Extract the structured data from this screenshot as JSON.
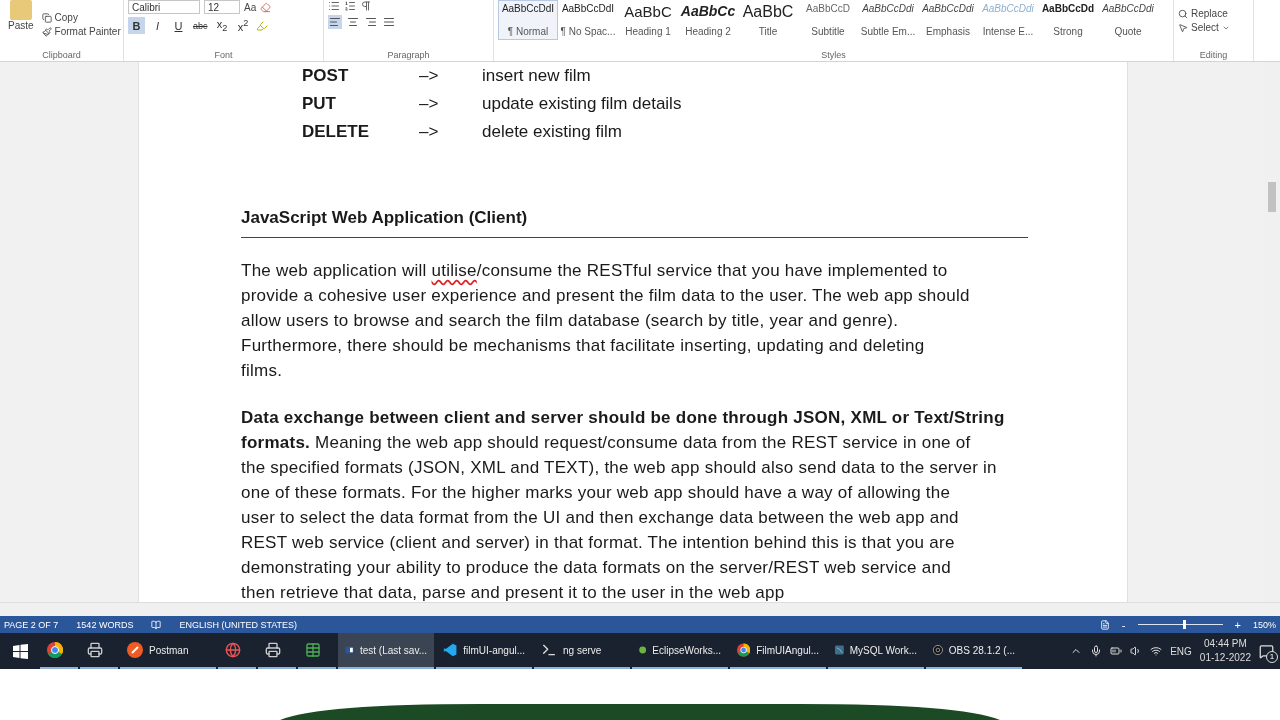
{
  "ribbon": {
    "clipboard": {
      "paste": "Paste",
      "copy": "Copy",
      "format_painter": "Format Painter",
      "label": "Clipboard"
    },
    "font": {
      "name": "Calibri",
      "size": "12",
      "case": "Aa",
      "format_buttons": [
        {
          "label": "B",
          "selected": true,
          "kind": "bold"
        },
        {
          "label": "I",
          "selected": false,
          "kind": "italic"
        },
        {
          "label": "U",
          "selected": false,
          "kind": "underline"
        },
        {
          "label": "abc",
          "selected": false,
          "kind": "strike"
        },
        {
          "label": "x$_{2}$",
          "selected": false,
          "kind": "plain"
        },
        {
          "label": "x$^{2}$",
          "selected": false,
          "kind": "plain"
        }
      ],
      "label": "Font"
    },
    "paragraph": {
      "alignments": [
        {
          "selected": true
        },
        {
          "selected": false
        },
        {
          "selected": false
        },
        {
          "selected": false
        }
      ],
      "label": "Paragraph"
    },
    "styles": {
      "items": [
        {
          "preview": "AaBbCcDdI",
          "name": "¶ Normal",
          "selected": true,
          "kind": "normal"
        },
        {
          "preview": "AaBbCcDdI",
          "name": "¶ No Spac...",
          "selected": false,
          "kind": "normal"
        },
        {
          "preview": "AaBbC",
          "name": "Heading 1",
          "selected": false,
          "kind": "heading"
        },
        {
          "preview": "AaBbCc",
          "name": "Heading 2",
          "selected": false,
          "kind": "heading2"
        },
        {
          "preview": "AaBbC",
          "name": "Title",
          "selected": false,
          "kind": "title"
        },
        {
          "preview": "AaBbCcD",
          "name": "Subtitle",
          "selected": false,
          "kind": "subtitle"
        },
        {
          "preview": "AaBbCcDdi",
          "name": "Subtle Em...",
          "selected": false,
          "kind": "emphasis"
        },
        {
          "preview": "AaBbCcDdi",
          "name": "Emphasis",
          "selected": false,
          "kind": "emphasis"
        },
        {
          "preview": "AaBbCcDdi",
          "name": "Intense E...",
          "selected": false,
          "kind": "intense"
        },
        {
          "preview": "AaBbCcDd",
          "name": "Strong",
          "selected": false,
          "kind": "strong"
        },
        {
          "preview": "AaBbCcDdi",
          "name": "Quote",
          "selected": false,
          "kind": "emphasis"
        }
      ],
      "label": "Styles"
    },
    "editing": {
      "replace": "Replace",
      "select": "Select",
      "label": "Editing"
    }
  },
  "document": {
    "methods": [
      {
        "method": "POST",
        "arrow": "–>",
        "action": "insert new film"
      },
      {
        "method": "PUT",
        "arrow": "–>",
        "action": "update existing film details"
      },
      {
        "method": "DELETE",
        "arrow": "–>",
        "action": "delete existing film"
      }
    ],
    "heading": "JavaScript Web Application (Client)",
    "paragraphs": [
      {
        "lines": [
          [
            {
              "text": "The web application will "
            },
            {
              "text": "utilise",
              "misspelled": true
            },
            {
              "text": "/consume the RESTful service that you have implemented to"
            }
          ],
          [
            {
              "text": "provide a cohesive user experience and present the film data to the user. The web app should"
            }
          ],
          [
            {
              "text": "allow users to browse and search the film database (search by title, year and genre)."
            }
          ],
          [
            {
              "text": "Furthermore, there should be mechanisms that facilitate inserting, updating and deleting"
            }
          ],
          [
            {
              "text": "films."
            }
          ]
        ]
      },
      {
        "lines": [
          [
            {
              "text": "**Data exchange between client and server should be done through JSON, XML or Text/String**"
            }
          ],
          [
            {
              "text": "**formats.** Meaning the web app should request/consume data from the REST service in one of"
            }
          ],
          [
            {
              "text": "the specified formats (JSON, XML and TEXT), the web app should also send data to the server in"
            }
          ],
          [
            {
              "text": "one of these formats. For the higher marks your web app should have a way of allowing the"
            }
          ],
          [
            {
              "text": "user to select the data format from the UI and then exchange data between the web app and"
            }
          ],
          [
            {
              "text": "REST web service (client and server) in that format. The intention behind this is that you are"
            }
          ],
          [
            {
              "text": "demonstrating your ability to produce the data formats on the server/REST web service and"
            }
          ],
          [
            {
              "text": "then retrieve that data, parse and present it to the user in the web app"
            }
          ]
        ]
      }
    ]
  },
  "status_bar": {
    "page": "PAGE 2 OF 7",
    "words": "1542 WORDS",
    "language": "ENGLISH (UNITED STATES)",
    "zoom_out": "-",
    "zoom_in": "+",
    "zoom": {
      "level": 0.53
    },
    "zoom_label": "150%"
  },
  "taskbar": {
    "items": [
      {
        "kind": "chrome",
        "selected": false
      },
      {
        "kind": "app",
        "selected": false
      },
      {
        "kind": "postman",
        "label": "Postman",
        "selected": false
      },
      {
        "kind": "tool",
        "selected": false
      },
      {
        "kind": "app",
        "selected": false
      },
      {
        "kind": "sheet",
        "selected": false
      },
      {
        "kind": "word",
        "label": "test (Last sav...",
        "selected": true
      },
      {
        "kind": "vscode",
        "label": "filmUI-angul...",
        "selected": false
      },
      {
        "kind": "terminal",
        "label": "ng serve",
        "selected": false
      },
      {
        "kind": "eclipse",
        "label": "EclipseWorks...",
        "selected": false
      },
      {
        "kind": "chrome",
        "label": "FilmUIAngul...",
        "selected": false
      },
      {
        "kind": "mysql",
        "label": "MySQL Work...",
        "selected": false
      },
      {
        "kind": "obs",
        "label": "OBS 28.1.2 (...",
        "selected": false
      }
    ],
    "language": "ENG",
    "time": "04:44 PM",
    "date": "01-12-2022",
    "notifications": "1"
  }
}
